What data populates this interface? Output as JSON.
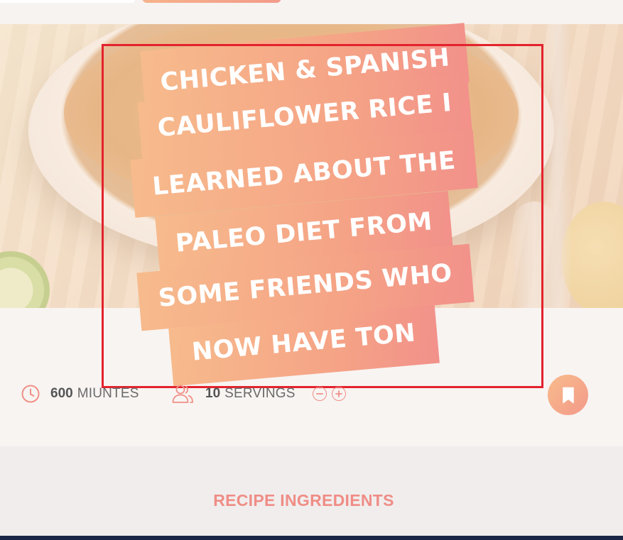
{
  "recipe": {
    "title_lines": [
      "CHICKEN & SPANISH",
      "CAULIFLOWER RICE I",
      "LEARNED ABOUT THE",
      "PALEO DIET FROM",
      "SOME FRIENDS WHO",
      "NOW HAVE TON"
    ],
    "time_value": "600",
    "time_unit": "MIUNTES",
    "servings_value": "10",
    "servings_unit": "SERVINGS"
  },
  "sections": {
    "ingredients_title": "RECIPE INGREDIENTS"
  },
  "icons": {
    "time": "clock-icon",
    "servings": "users-icon",
    "decrease": "minus-circle-icon",
    "increase": "plus-circle-icon",
    "bookmark": "bookmark-icon"
  },
  "colors": {
    "accent_start": "#f7bb8c",
    "accent_end": "#f2918a",
    "selection": "#e3222d",
    "footer": "#1b2546"
  }
}
